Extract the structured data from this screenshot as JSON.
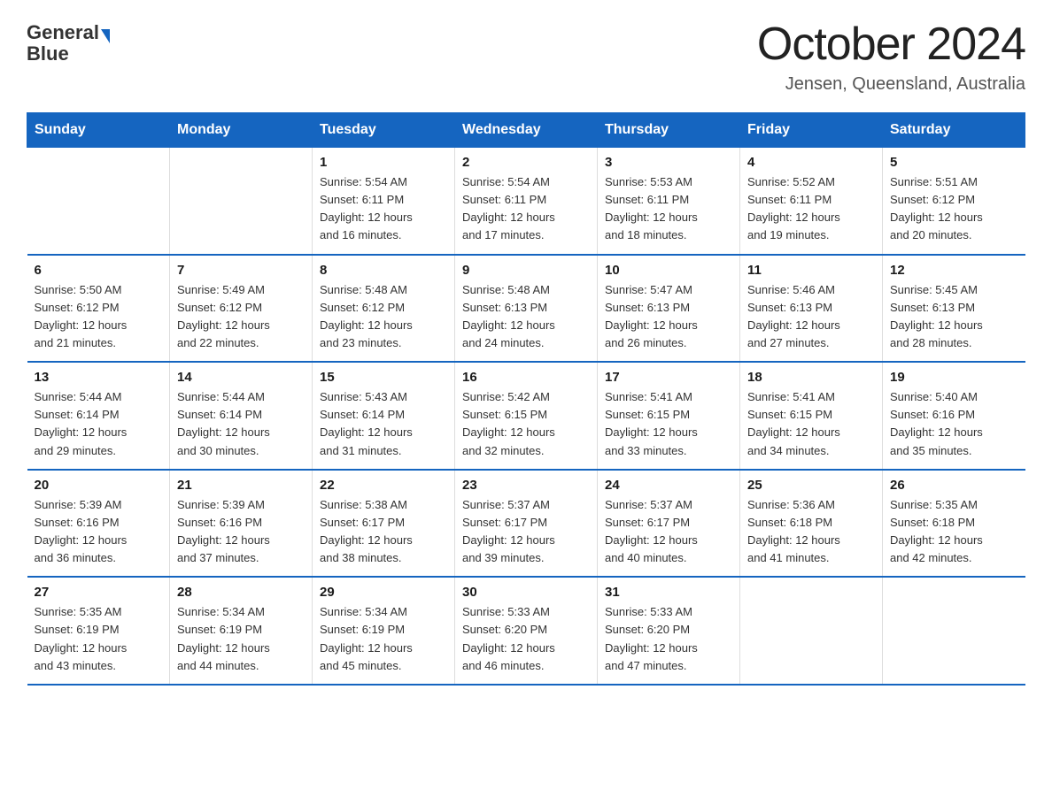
{
  "header": {
    "logo_line1": "General",
    "logo_line2": "Blue",
    "month_title": "October 2024",
    "location": "Jensen, Queensland, Australia"
  },
  "weekdays": [
    "Sunday",
    "Monday",
    "Tuesday",
    "Wednesday",
    "Thursday",
    "Friday",
    "Saturday"
  ],
  "weeks": [
    [
      {
        "day": "",
        "info": ""
      },
      {
        "day": "",
        "info": ""
      },
      {
        "day": "1",
        "info": "Sunrise: 5:54 AM\nSunset: 6:11 PM\nDaylight: 12 hours\nand 16 minutes."
      },
      {
        "day": "2",
        "info": "Sunrise: 5:54 AM\nSunset: 6:11 PM\nDaylight: 12 hours\nand 17 minutes."
      },
      {
        "day": "3",
        "info": "Sunrise: 5:53 AM\nSunset: 6:11 PM\nDaylight: 12 hours\nand 18 minutes."
      },
      {
        "day": "4",
        "info": "Sunrise: 5:52 AM\nSunset: 6:11 PM\nDaylight: 12 hours\nand 19 minutes."
      },
      {
        "day": "5",
        "info": "Sunrise: 5:51 AM\nSunset: 6:12 PM\nDaylight: 12 hours\nand 20 minutes."
      }
    ],
    [
      {
        "day": "6",
        "info": "Sunrise: 5:50 AM\nSunset: 6:12 PM\nDaylight: 12 hours\nand 21 minutes."
      },
      {
        "day": "7",
        "info": "Sunrise: 5:49 AM\nSunset: 6:12 PM\nDaylight: 12 hours\nand 22 minutes."
      },
      {
        "day": "8",
        "info": "Sunrise: 5:48 AM\nSunset: 6:12 PM\nDaylight: 12 hours\nand 23 minutes."
      },
      {
        "day": "9",
        "info": "Sunrise: 5:48 AM\nSunset: 6:13 PM\nDaylight: 12 hours\nand 24 minutes."
      },
      {
        "day": "10",
        "info": "Sunrise: 5:47 AM\nSunset: 6:13 PM\nDaylight: 12 hours\nand 26 minutes."
      },
      {
        "day": "11",
        "info": "Sunrise: 5:46 AM\nSunset: 6:13 PM\nDaylight: 12 hours\nand 27 minutes."
      },
      {
        "day": "12",
        "info": "Sunrise: 5:45 AM\nSunset: 6:13 PM\nDaylight: 12 hours\nand 28 minutes."
      }
    ],
    [
      {
        "day": "13",
        "info": "Sunrise: 5:44 AM\nSunset: 6:14 PM\nDaylight: 12 hours\nand 29 minutes."
      },
      {
        "day": "14",
        "info": "Sunrise: 5:44 AM\nSunset: 6:14 PM\nDaylight: 12 hours\nand 30 minutes."
      },
      {
        "day": "15",
        "info": "Sunrise: 5:43 AM\nSunset: 6:14 PM\nDaylight: 12 hours\nand 31 minutes."
      },
      {
        "day": "16",
        "info": "Sunrise: 5:42 AM\nSunset: 6:15 PM\nDaylight: 12 hours\nand 32 minutes."
      },
      {
        "day": "17",
        "info": "Sunrise: 5:41 AM\nSunset: 6:15 PM\nDaylight: 12 hours\nand 33 minutes."
      },
      {
        "day": "18",
        "info": "Sunrise: 5:41 AM\nSunset: 6:15 PM\nDaylight: 12 hours\nand 34 minutes."
      },
      {
        "day": "19",
        "info": "Sunrise: 5:40 AM\nSunset: 6:16 PM\nDaylight: 12 hours\nand 35 minutes."
      }
    ],
    [
      {
        "day": "20",
        "info": "Sunrise: 5:39 AM\nSunset: 6:16 PM\nDaylight: 12 hours\nand 36 minutes."
      },
      {
        "day": "21",
        "info": "Sunrise: 5:39 AM\nSunset: 6:16 PM\nDaylight: 12 hours\nand 37 minutes."
      },
      {
        "day": "22",
        "info": "Sunrise: 5:38 AM\nSunset: 6:17 PM\nDaylight: 12 hours\nand 38 minutes."
      },
      {
        "day": "23",
        "info": "Sunrise: 5:37 AM\nSunset: 6:17 PM\nDaylight: 12 hours\nand 39 minutes."
      },
      {
        "day": "24",
        "info": "Sunrise: 5:37 AM\nSunset: 6:17 PM\nDaylight: 12 hours\nand 40 minutes."
      },
      {
        "day": "25",
        "info": "Sunrise: 5:36 AM\nSunset: 6:18 PM\nDaylight: 12 hours\nand 41 minutes."
      },
      {
        "day": "26",
        "info": "Sunrise: 5:35 AM\nSunset: 6:18 PM\nDaylight: 12 hours\nand 42 minutes."
      }
    ],
    [
      {
        "day": "27",
        "info": "Sunrise: 5:35 AM\nSunset: 6:19 PM\nDaylight: 12 hours\nand 43 minutes."
      },
      {
        "day": "28",
        "info": "Sunrise: 5:34 AM\nSunset: 6:19 PM\nDaylight: 12 hours\nand 44 minutes."
      },
      {
        "day": "29",
        "info": "Sunrise: 5:34 AM\nSunset: 6:19 PM\nDaylight: 12 hours\nand 45 minutes."
      },
      {
        "day": "30",
        "info": "Sunrise: 5:33 AM\nSunset: 6:20 PM\nDaylight: 12 hours\nand 46 minutes."
      },
      {
        "day": "31",
        "info": "Sunrise: 5:33 AM\nSunset: 6:20 PM\nDaylight: 12 hours\nand 47 minutes."
      },
      {
        "day": "",
        "info": ""
      },
      {
        "day": "",
        "info": ""
      }
    ]
  ]
}
